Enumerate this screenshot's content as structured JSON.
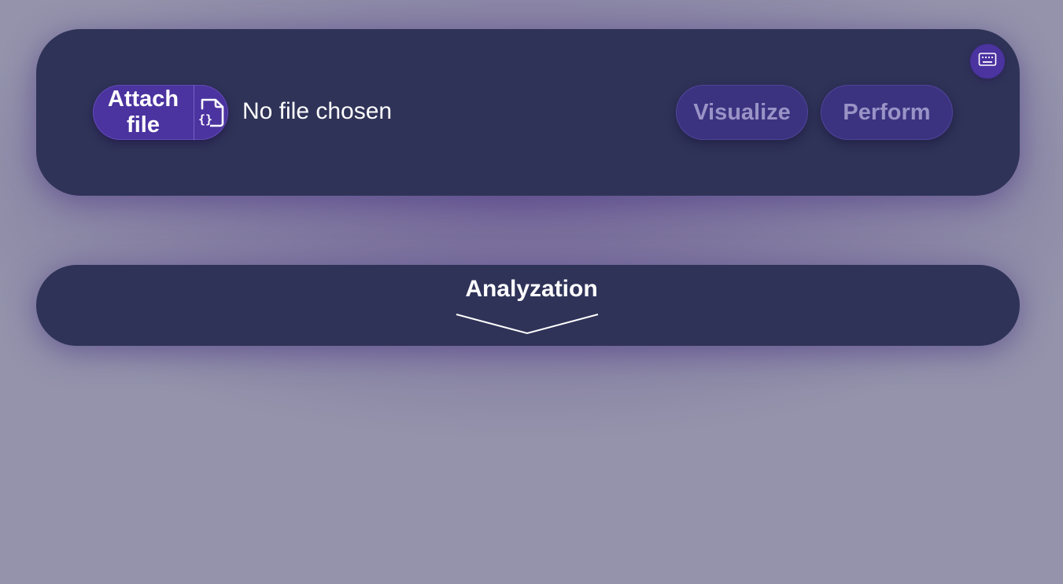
{
  "upload": {
    "attach_label_line1": "Attach",
    "attach_label_line2": "file",
    "attach_icon": "file-code-icon",
    "file_status": "No file chosen"
  },
  "actions": {
    "visualize_label": "Visualize",
    "perform_label": "Perform"
  },
  "toolbar": {
    "keyboard_icon": "keyboard-icon"
  },
  "analysis": {
    "title": "Analyzation",
    "toggle_icon": "chevron-down-icon"
  },
  "colors": {
    "background": "#9493ab",
    "panel": "#2f3358",
    "accent": "#4b33a0",
    "button_disabled_bg": "#3b3380",
    "button_disabled_text": "#9a93c6",
    "text": "#ffffff"
  }
}
